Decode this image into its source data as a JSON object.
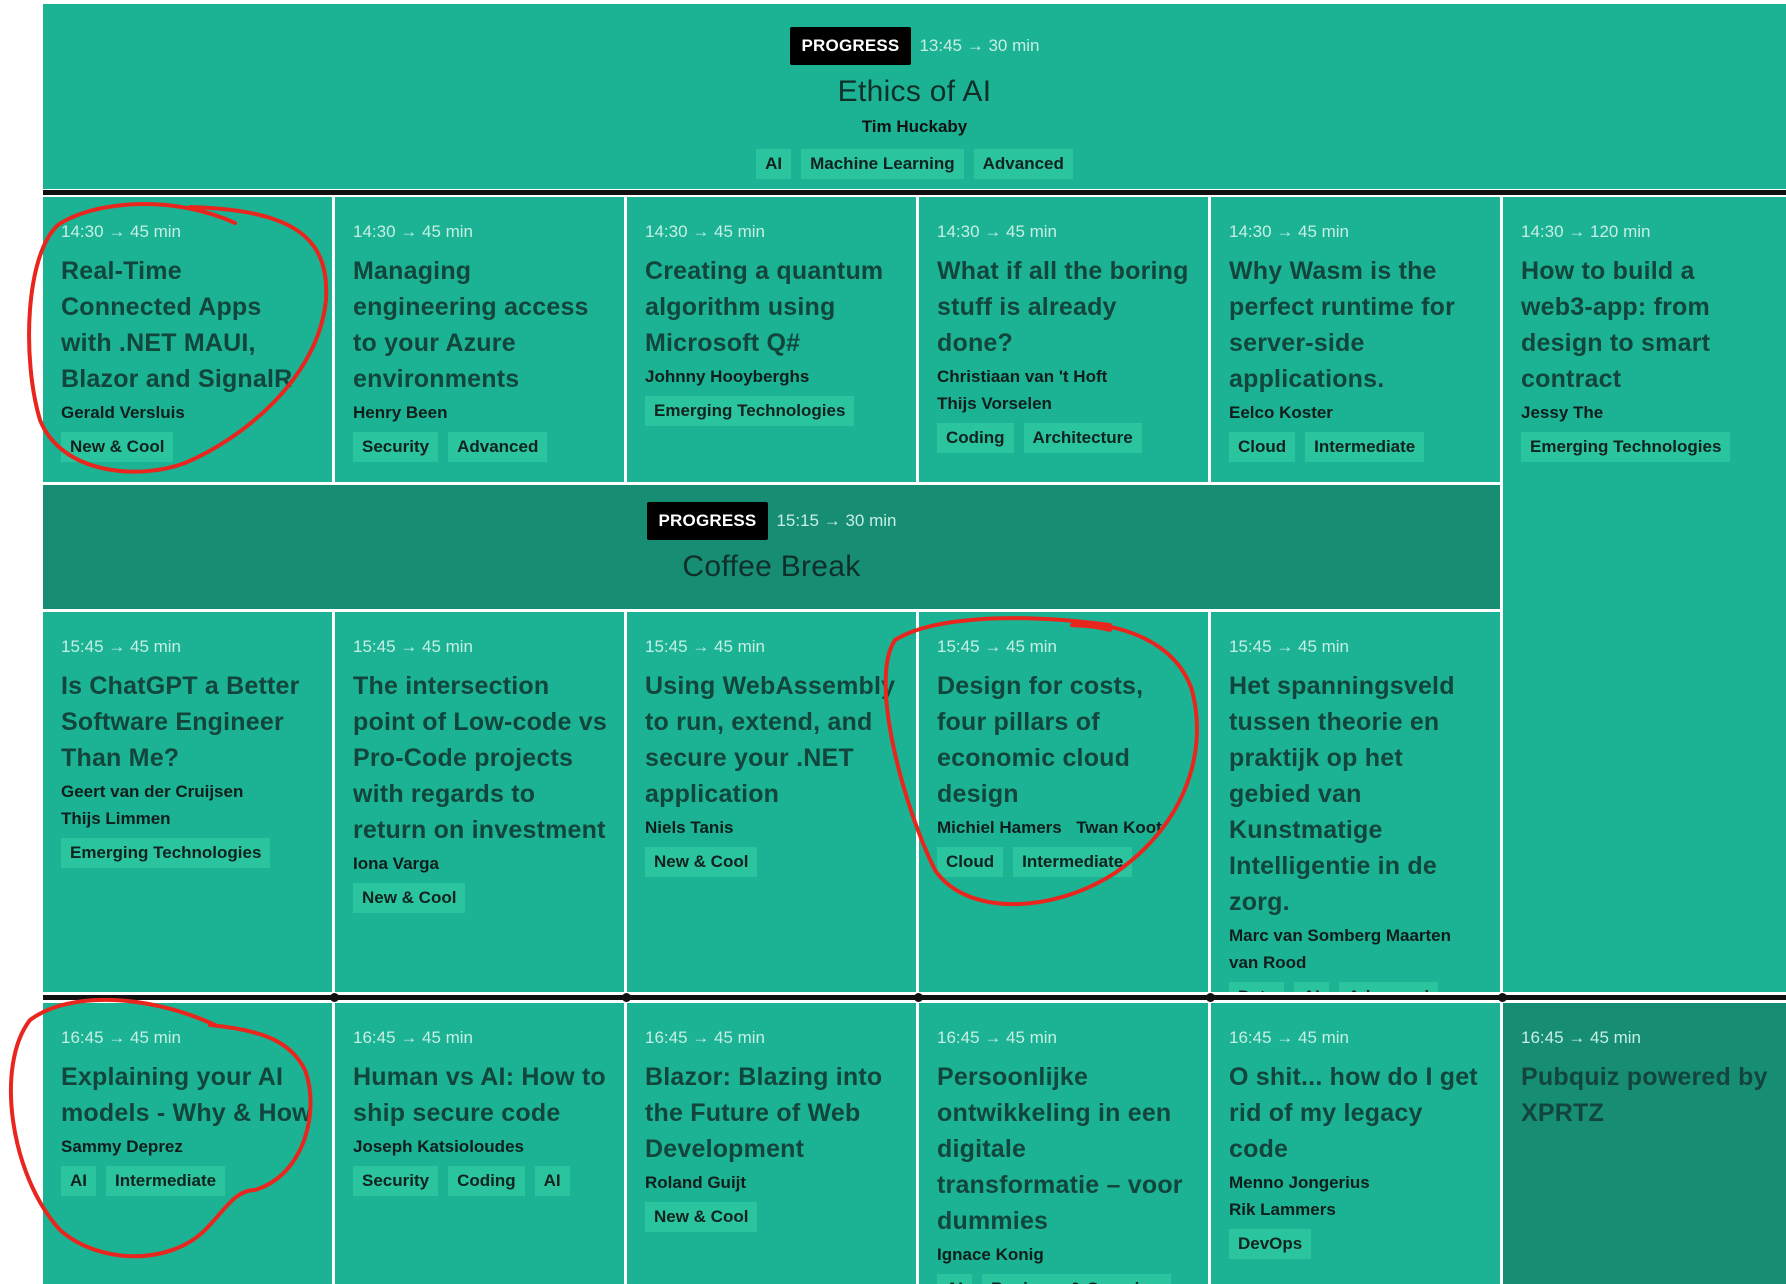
{
  "plenaries": {
    "ethics": {
      "badge": "PROGRESS",
      "time": "13:45 → 30 min",
      "title": "Ethics of AI",
      "speaker": "Tim Huckaby",
      "tags": [
        "AI",
        "Machine Learning",
        "Advanced"
      ]
    },
    "coffee": {
      "badge": "PROGRESS",
      "time": "15:15 → 30 min",
      "title": "Coffee Break"
    }
  },
  "sessions": {
    "r1c1": {
      "time": "14:30 → 45 min",
      "title": "Real-Time Connected Apps with .NET MAUI, Blazor and SignalR",
      "speakers": [
        "Gerald Versluis"
      ],
      "tags": [
        "New & Cool"
      ]
    },
    "r1c2": {
      "time": "14:30 → 45 min",
      "title": "Managing engineering access to your Azure environments",
      "speakers": [
        "Henry Been"
      ],
      "tags": [
        "Security",
        "Advanced"
      ]
    },
    "r1c3": {
      "time": "14:30 → 45 min",
      "title": "Creating a quantum algorithm using Microsoft Q#",
      "speakers": [
        "Johnny Hooyberghs"
      ],
      "tags": [
        "Emerging Technologies"
      ]
    },
    "r1c4": {
      "time": "14:30 → 45 min",
      "title": "What if all the boring stuff is already done?",
      "speakers": [
        "Christiaan van 't Hoft",
        "Thijs Vorselen"
      ],
      "tags": [
        "Coding",
        "Architecture"
      ]
    },
    "r1c5": {
      "time": "14:30 → 45 min",
      "title": "Why Wasm is the perfect runtime for server-side applications.",
      "speakers": [
        "Eelco Koster"
      ],
      "tags": [
        "Cloud",
        "Intermediate"
      ]
    },
    "r1c6": {
      "time": "14:30 → 120 min",
      "title": "How to build a web3-app: from design to smart contract",
      "speakers": [
        "Jessy The"
      ],
      "tags": [
        "Emerging Technologies"
      ]
    },
    "r2c1": {
      "time": "15:45 → 45 min",
      "title": "Is ChatGPT a Better Software Engineer Than Me?",
      "speakers": [
        "Geert van der Cruijsen",
        "Thijs Limmen"
      ],
      "tags": [
        "Emerging Technologies"
      ]
    },
    "r2c2": {
      "time": "15:45 → 45 min",
      "title": "The intersection point of Low-code vs Pro-Code projects with regards to return on investment",
      "speakers": [
        "Iona Varga"
      ],
      "tags": [
        "New & Cool"
      ]
    },
    "r2c3": {
      "time": "15:45 → 45 min",
      "title": "Using WebAssembly to run, extend, and secure your .NET application",
      "speakers": [
        "Niels Tanis"
      ],
      "tags": [
        "New & Cool"
      ]
    },
    "r2c4": {
      "time": "15:45 → 45 min",
      "title": "Design for costs, four pillars of economic cloud design",
      "speakers": [
        "Michiel Hamers",
        "Twan Koot"
      ],
      "tags": [
        "Cloud",
        "Intermediate"
      ]
    },
    "r2c5": {
      "time": "15:45 → 45 min",
      "title": "Het spanningsveld tussen theorie en praktijk op het gebied van Kunstmatige Intelligentie in de zorg.",
      "speakers": [
        "Marc van Somberg Maarten van Rood"
      ],
      "tags": [
        "Data",
        "AI",
        "Advanced"
      ]
    },
    "r3c1": {
      "time": "16:45 → 45 min",
      "title": "Explaining your AI models - Why & How",
      "speakers": [
        "Sammy Deprez"
      ],
      "tags": [
        "AI",
        "Intermediate"
      ]
    },
    "r3c2": {
      "time": "16:45 → 45 min",
      "title": "Human vs AI: How to ship secure code",
      "speakers": [
        "Joseph Katsioloudes"
      ],
      "tags": [
        "Security",
        "Coding",
        "AI"
      ]
    },
    "r3c3": {
      "time": "16:45 → 45 min",
      "title": "Blazor: Blazing into the Future of Web Development",
      "speakers": [
        "Roland Guijt"
      ],
      "tags": [
        "New & Cool"
      ]
    },
    "r3c4": {
      "time": "16:45 → 45 min",
      "title": "Persoonlijke ontwikkeling in een digitale transformatie – voor dummies",
      "speakers": [
        "Ignace Konig"
      ],
      "tags": [
        "AI",
        "Beginner & Overview"
      ]
    },
    "r3c5": {
      "time": "16:45 → 45 min",
      "title": "O shit... how do I get rid of my legacy code",
      "speakers": [
        "Menno Jongerius",
        "Rik Lammers"
      ],
      "tags": [
        "DevOps"
      ]
    },
    "r3c6": {
      "time": "16:45 → 45 min",
      "title": "Pubquiz powered by XPRTZ",
      "speakers": [],
      "tags": []
    }
  },
  "colors": {
    "cell": "#1bb394",
    "cell_dark": "#178d73",
    "tag_bg": "#2ac49f",
    "annotation": "#e8261e"
  }
}
